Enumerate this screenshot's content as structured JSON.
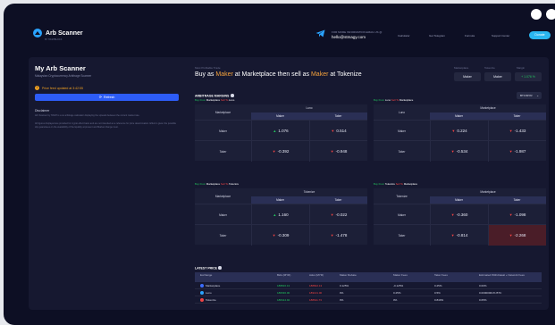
{
  "header": {
    "brand": "Arb Scanner",
    "brand_sub": "BY HASHBLOCK",
    "contact_label": "FOR MORE INFORMATION EMAIL US @",
    "contact_email": "hello@stmagy.com",
    "nav": [
      "Calculator",
      "Get Telegram",
      "Formula",
      "Support Center"
    ],
    "nav_button": "Donate"
  },
  "sidebar": {
    "title": "My Arb Scanner",
    "subtitle": "Malaysian Cryptocurrency Arbitrage Scanner",
    "updated": "Price feed updated at 3:42:55",
    "refresh": "Refresh",
    "disclaimer_title": "Disclaimer",
    "disclaimer_p1": "Arb Scanner by HASH is a no arbitrage calculator displaying the spreads between the current market rate.",
    "disclaimer_p2": "All figures displayed are provided for crypto effect basis and are not intended as a reference for price determination. Effect is given the possible slip guarantees on the availability of the liquidity at present and Market change must."
  },
  "opportunity": {
    "label": "Most Profitable Trade",
    "parts": [
      "Buy as ",
      "Maker",
      " at Marketplace then sell as ",
      "Maker",
      " at Tokenize"
    ],
    "selectors": [
      {
        "label": "Marketplace",
        "value": "Maker"
      },
      {
        "label": "Tokenize",
        "value": "Maker"
      },
      {
        "label": "Margin",
        "value": "+ 1.076 %"
      }
    ]
  },
  "margins": {
    "title": "ARBITRAGE MARGINS",
    "dropdown": "BTC/MYR",
    "tables": [
      {
        "label": [
          "Buy From",
          "Luno",
          "Sell To",
          "Marketplace"
        ],
        "label_colors": [
          "g",
          "w",
          "r",
          "w"
        ],
        "corner": "Luno",
        "group": "Marketplace",
        "cols": [
          "Maker",
          "Taker"
        ],
        "rows": [
          {
            "label": "Maker",
            "cells": [
              {
                "v": "0.224",
                "up": false
              },
              {
                "v": "-1.433",
                "up": false
              }
            ]
          },
          {
            "label": "Taker",
            "cells": [
              {
                "v": "-0.534",
                "up": false
              },
              {
                "v": "-1.987",
                "up": false
              }
            ]
          }
        ]
      },
      {
        "label": [
          "Buy From",
          "Marketplace",
          "Sell To",
          "Luno"
        ],
        "label_colors": [
          "g",
          "w",
          "r",
          "w"
        ],
        "corner": "Marketplace",
        "group": "Luno",
        "cols": [
          "Maker",
          "Taker"
        ],
        "rows": [
          {
            "label": "Maker",
            "cells": [
              {
                "v": "1.076",
                "up": true
              },
              {
                "v": "0.514",
                "up": false
              }
            ]
          },
          {
            "label": "Taker",
            "cells": [
              {
                "v": "-0.392",
                "up": false
              },
              {
                "v": "-0.948",
                "up": false
              }
            ]
          }
        ]
      },
      {
        "label": [
          "Buy From",
          "Marketplace",
          "Sell To",
          "Tokenize"
        ],
        "label_colors": [
          "g",
          "w",
          "r",
          "w"
        ],
        "corner": "Marketplace",
        "group": "Tokenize",
        "cols": [
          "Maker",
          "Taker"
        ],
        "rows": [
          {
            "label": "Maker",
            "cells": [
              {
                "v": "1.160",
                "up": true
              },
              {
                "v": "-0.022",
                "up": false
              }
            ]
          },
          {
            "label": "Taker",
            "cells": [
              {
                "v": "-0.309",
                "up": false
              },
              {
                "v": "-1.478",
                "up": false
              }
            ]
          }
        ]
      },
      {
        "label": [
          "Buy From",
          "Tokenize",
          "Sell To",
          "Marketplace"
        ],
        "label_colors": [
          "g",
          "w",
          "r",
          "w"
        ],
        "corner": "Tokenize",
        "group": "Marketplace",
        "cols": [
          "Maker",
          "Taker"
        ],
        "rows": [
          {
            "label": "Maker",
            "cells": [
              {
                "v": "-0.360",
                "up": false
              },
              {
                "v": "-1.098",
                "up": false
              }
            ]
          },
          {
            "label": "Taker",
            "cells": [
              {
                "v": "-0.814",
                "up": false
              },
              {
                "v": "-2.268",
                "up": false,
                "neg": true
              }
            ]
          }
        ]
      }
    ]
  },
  "latest_price": {
    "title": "LATEST PRICE",
    "headers": [
      "Exchange",
      "Bids (MYR)",
      "Asks (MYR)",
      "Maker Rebate",
      "Maker Fees",
      "Taker Fees",
      "Estimated Withdrawal + Network Fees"
    ],
    "rows": [
      {
        "exchange": "Marketplace",
        "icon_color": "#3b6cff",
        "bid": "188816.13",
        "ask": "188822.13",
        "rebate": "0.125%",
        "maker": "-0.125%",
        "taker": "0.25%",
        "withdraw": "0.00%"
      },
      {
        "exchange": "Luno",
        "icon_color": "#2aa3ff",
        "bid": "188336.00",
        "ask": "189131.00",
        "rebate": "0%",
        "maker": "0.25%",
        "taker": "0.5%",
        "withdraw": "0.00000001% BTC"
      },
      {
        "exchange": "Tokenize",
        "icon_color": "#ef4444",
        "bid": "188414.92",
        "ask": "188611.73",
        "rebate": "0%",
        "maker": "0%",
        "taker": "0.840%",
        "withdraw": "0.05%"
      }
    ]
  }
}
